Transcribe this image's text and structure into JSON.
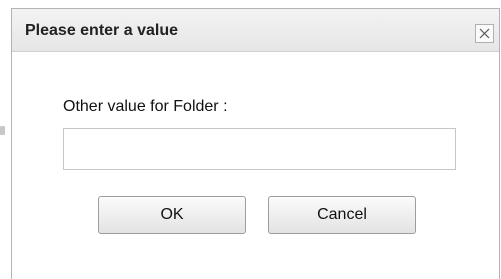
{
  "dialog": {
    "title": "Please enter a value",
    "close_icon": "close-icon",
    "field_label": "Other value for Folder :",
    "input_value": "",
    "input_placeholder": "",
    "ok_label": "OK",
    "cancel_label": "Cancel"
  },
  "colors": {
    "titlebar": "#e9e9e9",
    "border": "#b4b4b4",
    "button_border": "#9d9d9d"
  }
}
